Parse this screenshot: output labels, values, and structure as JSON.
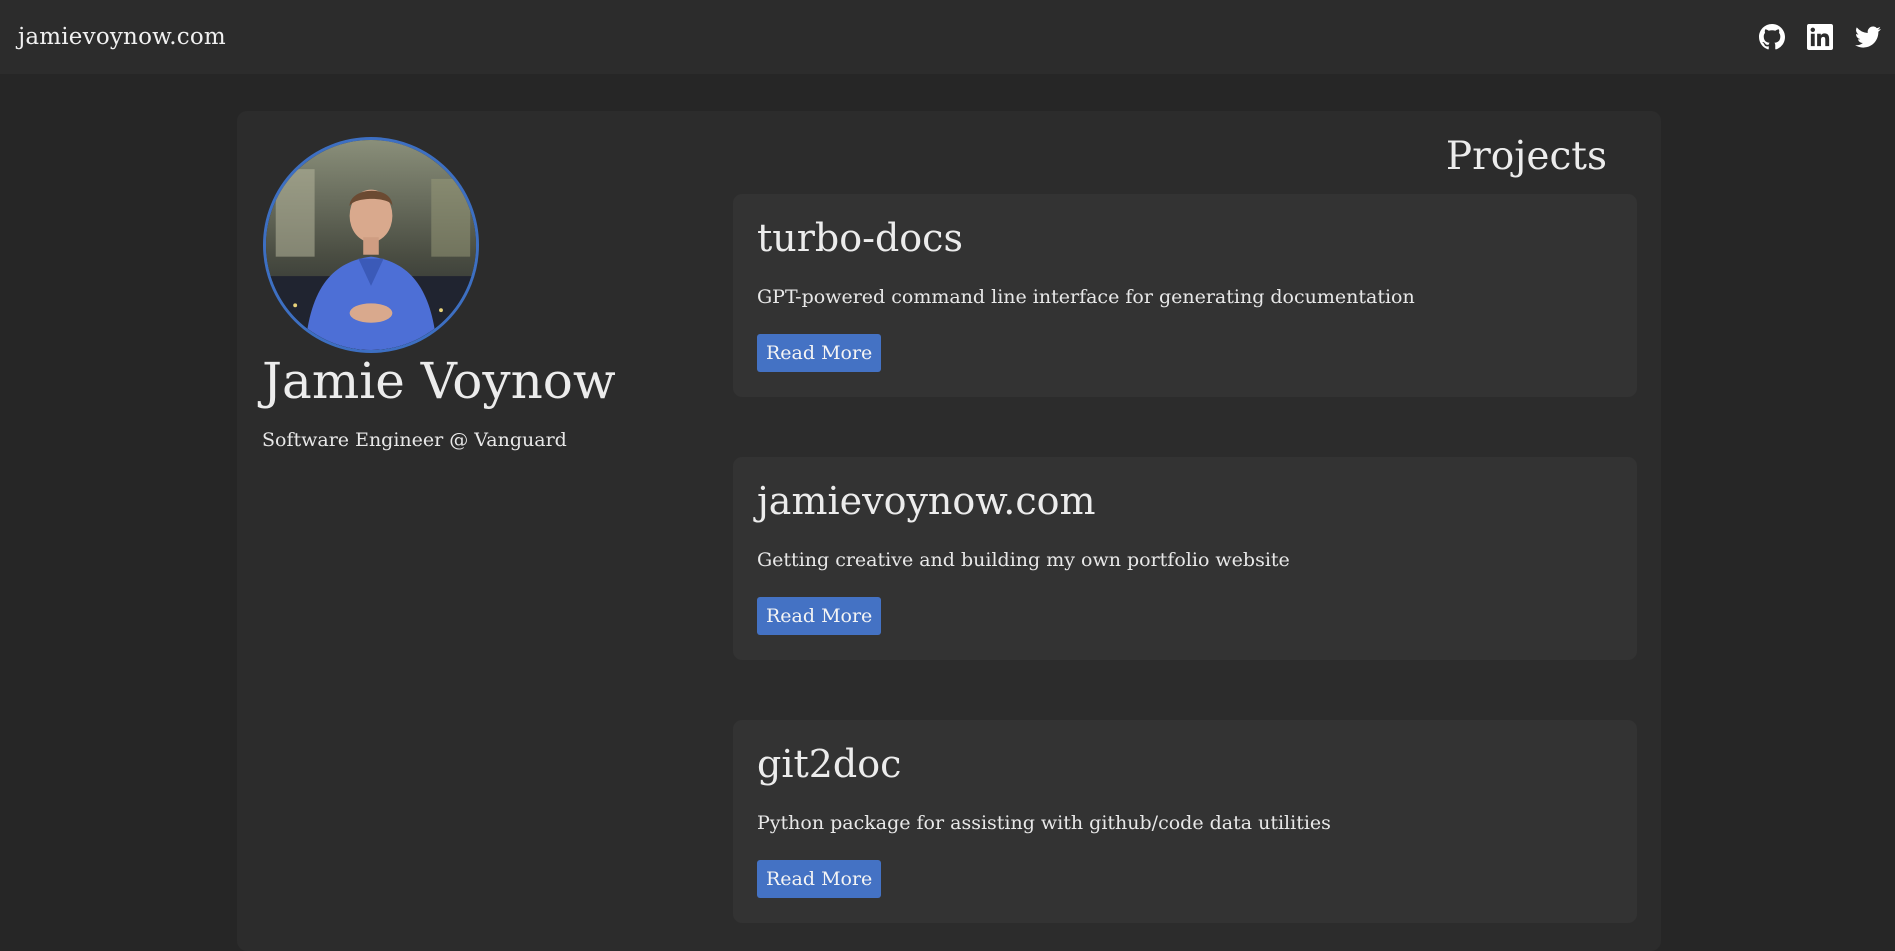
{
  "nav": {
    "brand": "jamievoynow.com",
    "social": [
      {
        "name": "github-icon"
      },
      {
        "name": "linkedin-icon"
      },
      {
        "name": "twitter-icon"
      }
    ]
  },
  "profile": {
    "name": "Jamie Voynow",
    "role": "Software Engineer @ Vanguard",
    "avatar_border_color": "#3d6fc2"
  },
  "projects": {
    "heading": "Projects",
    "items": [
      {
        "title": "turbo-docs",
        "description": "GPT-powered command line interface for generating documentation",
        "button": "Read More"
      },
      {
        "title": "jamievoynow.com",
        "description": "Getting creative and building my own portfolio website",
        "button": "Read More"
      },
      {
        "title": "git2doc",
        "description": "Python package for assisting with github/code data utilities",
        "button": "Read More"
      }
    ]
  },
  "colors": {
    "page_bg": "#262626",
    "card_bg": "#2c2c2c",
    "project_bg": "#333333",
    "accent": "#4472c4"
  }
}
